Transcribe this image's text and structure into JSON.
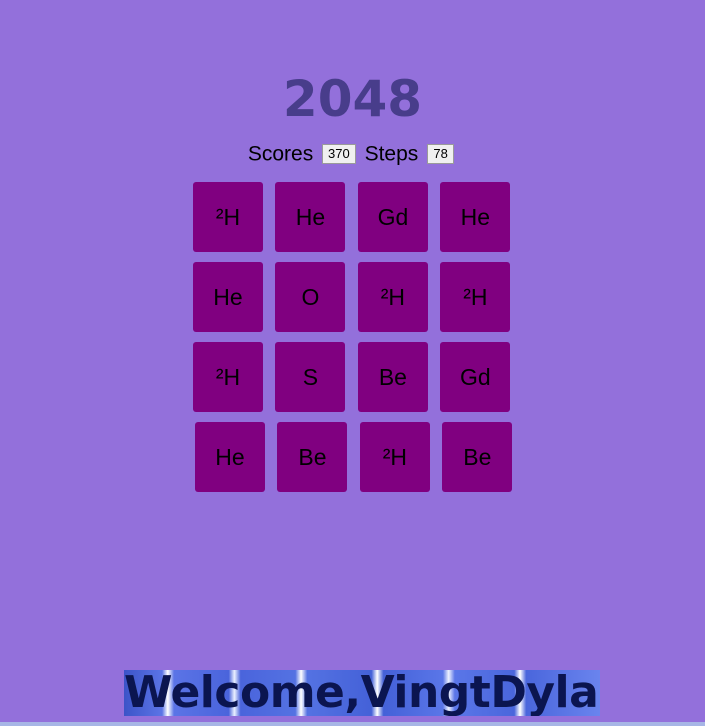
{
  "title": "2048",
  "scores": {
    "label": "Scores",
    "value": "370"
  },
  "steps": {
    "label": "Steps",
    "value": "78"
  },
  "board": [
    [
      "²H",
      "He",
      "Gd",
      "He"
    ],
    [
      "He",
      "O",
      "²H",
      "²H"
    ],
    [
      "²H",
      "S",
      "Be",
      "Gd"
    ],
    [
      "He",
      "Be",
      "²H",
      "Be"
    ]
  ],
  "welcome": "Welcome,VingtDylan",
  "colors": {
    "background": "#9370db",
    "title": "#483d8b",
    "tile": "#800080"
  }
}
